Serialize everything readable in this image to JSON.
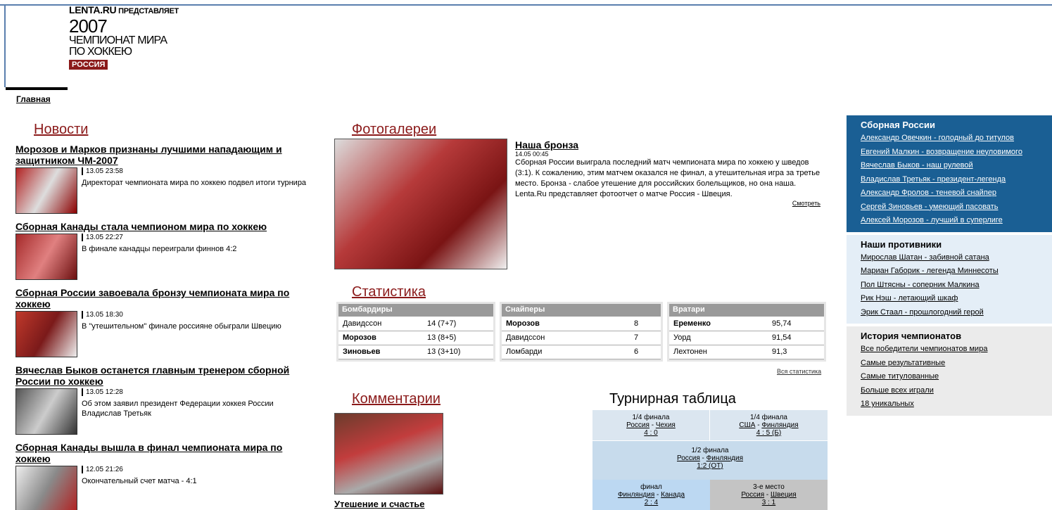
{
  "logo": {
    "top_brand": "LENTA.RU",
    "top_rest": " ПРЕДСТАВЛЯЕТ",
    "year": "2007",
    "line1": "ЧЕМПИОНАТ МИРА",
    "line2": "ПО ХОККЕЮ",
    "badge": "РОССИЯ"
  },
  "nav": {
    "home": "Главная"
  },
  "sections": {
    "news": "Новости",
    "photo": "Фотогалереи",
    "stats": "Статистика",
    "comments": "Комментарии",
    "standings": "Турнирная таблица"
  },
  "news": [
    {
      "title": "Морозов и Марков признаны лучшими нападающим и защитником ЧМ-2007",
      "date": "13.05 23:58",
      "desc": "Директорат чемпионата мира по хоккею подвел итоги турнира"
    },
    {
      "title": "Сборная Канады стала чемпионом мира по хоккею",
      "date": "13.05 22:27",
      "desc": "В финале канадцы переиграли финнов 4:2"
    },
    {
      "title": "Сборная России завоевала бронзу чемпионата мира по хоккею",
      "date": "13.05 18:30",
      "desc": "В \"утешительном\" финале россияне обыграли Швецию"
    },
    {
      "title": "Вячеслав Быков останется главным тренером сборной России по хоккею",
      "date": "13.05 12:28",
      "desc": "Об этом заявил президент Федерации хоккея России Владислав Третьяк"
    },
    {
      "title": "Сборная Канады вышла в финал чемпионата мира по хоккею",
      "date": "12.05 21:26",
      "desc": "Окончательный счет матча - 4:1"
    }
  ],
  "photo": {
    "title": "Наша бронза",
    "date": "14.05 00:45",
    "desc": "Сборная России выиграла последний матч чемпионата мира по хоккею у шведов (3:1). К сожалению, этим матчем оказался не финал, а утешительная игра за третье место. Бронза - слабое утешение для российских болельщиков, но она наша. Lenta.Ru представляет фотоотчет о матче Россия - Швеция.",
    "more": "Смотреть"
  },
  "stats": {
    "scorers": {
      "header": "Бомбардиры",
      "rows": [
        [
          "Давидссон",
          "14 (7+7)"
        ],
        [
          "Морозов",
          "13 (8+5)"
        ],
        [
          "Зиновьев",
          "13 (3+10)"
        ]
      ]
    },
    "snipers": {
      "header": "Снайперы",
      "rows": [
        [
          "Морозов",
          "8"
        ],
        [
          "Давидссон",
          "7"
        ],
        [
          "Ломбарди",
          "6"
        ]
      ]
    },
    "goalies": {
      "header": "Вратари",
      "rows": [
        [
          "Еременко",
          "95,74"
        ],
        [
          "Уорд",
          "91,54"
        ],
        [
          "Лехтонен",
          "91,3"
        ]
      ]
    },
    "all": "Вся статистика"
  },
  "comment": {
    "title": "Утешение и счастье"
  },
  "bracket": {
    "qf1": {
      "stage": "1/4 финала",
      "t1": "Россия",
      "t2": "Чехия",
      "score": "4 : 0"
    },
    "qf2": {
      "stage": "1/4 финала",
      "t1": "США",
      "t2": "Финляндия",
      "score": "4 : 5 (Б)"
    },
    "sf": {
      "stage": "1/2 финала",
      "t1": "Россия",
      "t2": "Финляндия",
      "score": "1:2 (ОТ)"
    },
    "final": {
      "stage": "финал",
      "t1": "Финляндия",
      "t2": "Канада",
      "score": "2 : 4"
    },
    "third": {
      "stage": "3-е место",
      "t1": "Россия",
      "t2": "Швеция",
      "score": "3 : 1"
    }
  },
  "team": {
    "title": "Сборная России",
    "items": [
      "Александр Овечкин - голодный до титулов",
      "Евгений Малкин - возвращение неуловимого",
      "Вячеслав Быков - наш рулевой",
      "Владислав Третьяк - президент-легенда",
      "Александр Фролов - теневой снайпер",
      "Сергей Зиновьев - умеющий пасовать",
      "Алексей Морозов - лучший в суперлиге"
    ]
  },
  "rivals": {
    "title": "Наши противники",
    "items": [
      "Мирослав Шатан - забивной сатана",
      "Мариан Габорик - легенда Миннесоты",
      "Пол Штясны - соперник Малкина",
      "Рик Нэш - летающий шкаф",
      "Эрик Стаал - прошлогодний герой"
    ]
  },
  "history": {
    "title": "История чемпионатов",
    "items": [
      "Все победители чемпионатов мира",
      "Самые результативные",
      "Самые титулованные",
      "Больше всех играли",
      "18 уникальных"
    ]
  }
}
